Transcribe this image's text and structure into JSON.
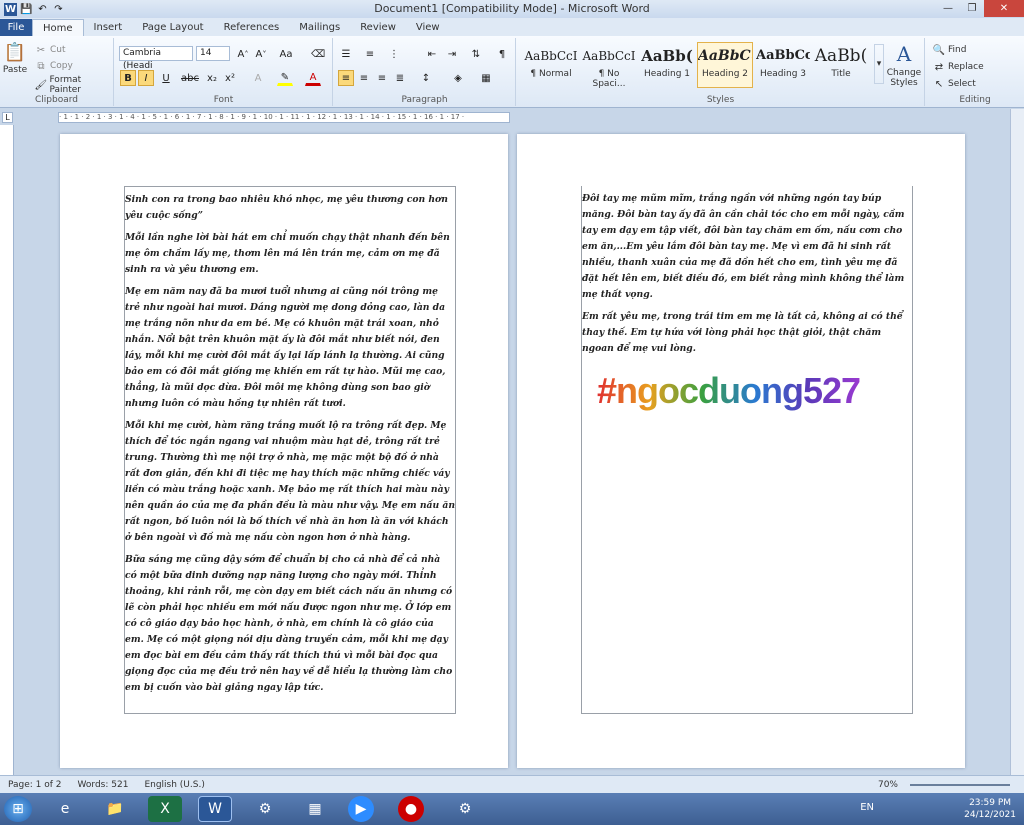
{
  "window": {
    "title": "Document1 [Compatibility Mode] - Microsoft Word"
  },
  "tabs": [
    "File",
    "Home",
    "Insert",
    "Page Layout",
    "References",
    "Mailings",
    "Review",
    "View"
  ],
  "clipboard": {
    "paste": "Paste",
    "cut": "Cut",
    "copy": "Copy",
    "format_painter": "Format Painter",
    "label": "Clipboard"
  },
  "font": {
    "name": "Cambria (Headi",
    "size": "14",
    "label": "Font"
  },
  "paragraph": {
    "label": "Paragraph"
  },
  "styles": {
    "items": [
      {
        "sample": "AaBbCcI",
        "name": "¶ Normal"
      },
      {
        "sample": "AaBbCcI",
        "name": "¶ No Spaci..."
      },
      {
        "sample": "AaBb(",
        "name": "Heading 1"
      },
      {
        "sample": "AaBbC(",
        "name": "Heading 2"
      },
      {
        "sample": "AaBbCc",
        "name": "Heading 3"
      },
      {
        "sample": "AaBb(",
        "name": "Title"
      }
    ],
    "change": "Change Styles",
    "label": "Styles"
  },
  "editing": {
    "find": "Find",
    "replace": "Replace",
    "select": "Select",
    "label": "Editing"
  },
  "page1": {
    "paragraphs": [
      "Sinh con ra trong bao nhiêu khó nhọc, mẹ yêu thương con hơn yêu cuộc sống”",
      "Mỗi lần nghe lời bài hát em chỉ muốn chạy thật nhanh đến bên mẹ ôm chầm lấy mẹ, thơm lên má lên trán mẹ, cảm ơn mẹ đã sinh ra và yêu thương em.",
      "Mẹ em năm nay đã ba mươi tuổi nhưng ai cũng nói trông mẹ trẻ như ngoài hai mươi. Dáng người mẹ dong dỏng cao, làn da mẹ trắng nõn như da em bé. Mẹ có khuôn mặt trái xoan, nhỏ nhắn. Nổi bật trên khuôn mặt ấy là đôi mắt như biết nói, đen láy, mỗi khi mẹ cười đôi mắt ấy lại lấp lánh lạ thường. Ai cũng bảo em có đôi mắt giống mẹ khiến em rất tự hào. Mũi mẹ cao, thẳng, là mũi dọc dừa. Đôi môi mẹ không dùng son bao giờ nhưng luôn có màu hồng tự nhiên rất tươi.",
      "Mỗi khi mẹ cười, hàm răng trắng muốt lộ ra trông rất đẹp. Mẹ thích để tóc ngắn ngang vai nhuộm màu hạt dẻ, trông rất trẻ trung. Thường thì mẹ nội trợ ở nhà, mẹ mặc một bộ đồ ở nhà rất đơn giản, đến khi đi tiệc mẹ hay thích mặc những chiếc váy liền có màu trắng hoặc xanh. Mẹ bảo mẹ rất thích hai màu này nên quần áo của mẹ đa phần đều là màu như vậy. Mẹ em nấu ăn rất ngon, bố luôn nói là bố thích về nhà ăn hơn là ăn với khách ở bên ngoài vì đồ mà mẹ nấu còn ngon hơn ở nhà hàng.",
      "Bữa sáng mẹ cũng dậy sớm để chuẩn bị cho cả nhà để cả nhà có một bữa dinh dưỡng nạp năng lượng cho ngày mới. Thỉnh thoảng, khi rảnh rỗi, mẹ còn dạy em biết cách nấu ăn nhưng có lẽ còn phải học nhiều em mới nấu được ngon như mẹ. Ở lớp em có cô giáo dạy bảo học hành, ở nhà, em chính là cô giáo của em. Mẹ có một giọng nói dịu dàng truyền cảm, mỗi khi mẹ dạy em đọc bài em đều cảm thấy rất thích thú vì mỗi bài đọc qua giọng đọc của mẹ đều trở nên hay về dễ hiểu lạ thường làm cho em bị cuốn vào bài giảng ngay lập tức."
    ]
  },
  "page2": {
    "paragraphs": [
      "Đôi tay mẹ mũm mĩm, trắng ngần với những ngón tay búp măng. Đôi bàn tay ấy đã ân cần chải tóc cho em mỗi ngày, cầm tay em dạy em tập viết, đôi bàn tay chăm em ốm, nấu cơm cho em ăn,...Em yêu lắm đôi bàn tay mẹ. Mẹ vì em đã hi sinh rất nhiều, thanh xuân của mẹ đã dồn hết cho em, tình yêu mẹ đã đặt hết lên em, biết điều đó, em biết rằng mình không thể làm mẹ thất vọng.",
      "Em rất yêu mẹ, trong trái tim em mẹ là tất cả, không ai có thể thay thế. Em tự hứa với lòng phải học thật giỏi, thật chăm ngoan để mẹ vui lòng."
    ],
    "wordart": "#ngocduong527"
  },
  "ruler": "· 1 · 1 · 2 · 1 · 3 · 1 · 4 · 1 · 5 · 1 · 6 · 1 · 7 · 1 · 8 · 1 · 9 · 1 · 10 · 1 · 11 · 1 · 12 · 1 · 13 · 1 · 14 · 1 · 15 · 1 · 16 · 1 · 17 ·",
  "status": {
    "page": "Page: 1 of 2",
    "words": "Words: 521",
    "lang": "English (U.S.)",
    "zoom": "70%"
  },
  "tray": {
    "lang": "EN",
    "time": "23:59 PM",
    "date": "24/12/2021"
  }
}
